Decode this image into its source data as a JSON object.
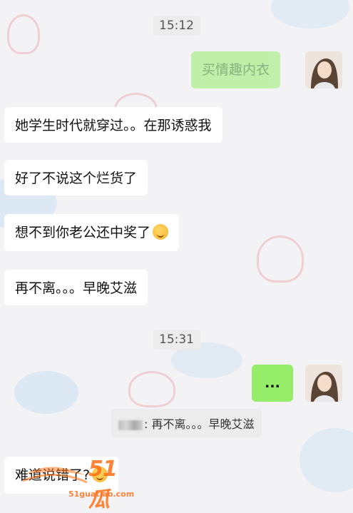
{
  "messages": [
    {
      "type": "time",
      "text": "15:12"
    },
    {
      "type": "sent",
      "text": "买情趣内衣"
    },
    {
      "type": "received",
      "text": "她学生时代就穿过。。在那诱惑我"
    },
    {
      "type": "received",
      "text": "好了不说这个烂货了"
    },
    {
      "type": "received",
      "text": "想不到你老公还中奖了"
    },
    {
      "type": "received",
      "text": "再不离。。。早晚艾滋"
    },
    {
      "type": "time",
      "text": "15:31"
    },
    {
      "type": "sent",
      "text": "..."
    },
    {
      "type": "quote",
      "text": "再不离。。。早晚艾滋",
      "sender_prefix": ":"
    },
    {
      "type": "received",
      "text": "难道说错了?"
    }
  ],
  "watermark": {
    "logo": "51瓜",
    "url": "51guatiao.com"
  },
  "colors": {
    "sent_bubble": "#95ec69",
    "received_bubble": "#ffffff",
    "background": "#f3f3f6"
  }
}
